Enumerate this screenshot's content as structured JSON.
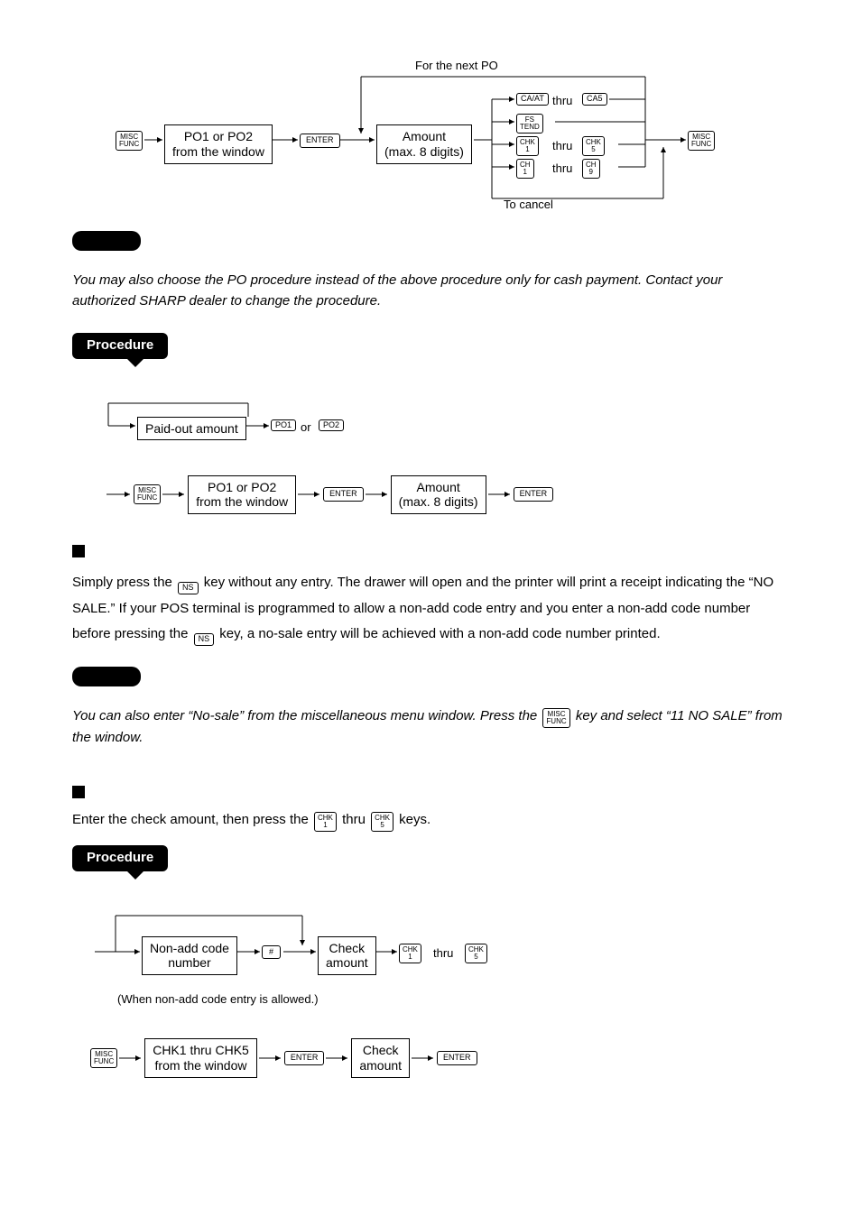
{
  "diag1": {
    "top_label": "For the next PO",
    "bottom_label": "To cancel",
    "misc_func": "MISC\nFUNC",
    "po_box": "PO1 or PO2\nfrom the window",
    "enter": "ENTER",
    "amount_box": "Amount\n(max. 8 digits)",
    "caat": "CA/AT",
    "ca5": "CA5",
    "fstend": "FS\nTEND",
    "chk1": "CHK\n1",
    "chk5": "CHK\n5",
    "ch1": "CH\n1",
    "ch9": "CH\n9",
    "thru": "thru"
  },
  "note1": "You may also choose the PO procedure instead of the above procedure only for cash payment. Contact your authorized SHARP dealer to change the procedure.",
  "procedure_label": "Procedure",
  "proc1": {
    "paid_out": "Paid-out amount",
    "po1": "PO1",
    "po2": "PO2",
    "or": "or",
    "misc_func": "MISC\nFUNC",
    "po_box": "PO1 or PO2\nfrom the window",
    "enter": "ENTER",
    "amount_box": "Amount\n(max. 8 digits)"
  },
  "nosale": {
    "p1a": "Simply press the ",
    "ns": "NS",
    "p1b": " key without any entry.  The drawer will open and the printer will print a receipt indicating the “NO SALE.”  If your POS terminal is programmed to allow a non-add code entry and you enter a non-add code number before pressing the ",
    "p1c": " key, a no-sale entry will be achieved with a non-add code number printed."
  },
  "note2a": "You can also enter “No-sale” from the miscellaneous menu window. Press the ",
  "note2_key": "MISC\nFUNC",
  "note2b": " key and select “11 NO SALE” from the window.",
  "check": {
    "intro_a": "Enter the check amount, then press the ",
    "chk1": "CHK\n1",
    "thru": "thru",
    "chk5": "CHK\n5",
    "intro_b": " keys."
  },
  "proc2": {
    "nonadd_box": "Non-add code\nnumber",
    "hash": "#",
    "check_amount": "Check\namount",
    "chk1": "CHK\n1",
    "thru": "thru",
    "chk5": "CHK\n5",
    "caption": "(When non-add code entry is allowed.)",
    "misc_func": "MISC\nFUNC",
    "chk_box": "CHK1 thru CHK5\nfrom the window",
    "enter": "ENTER"
  }
}
